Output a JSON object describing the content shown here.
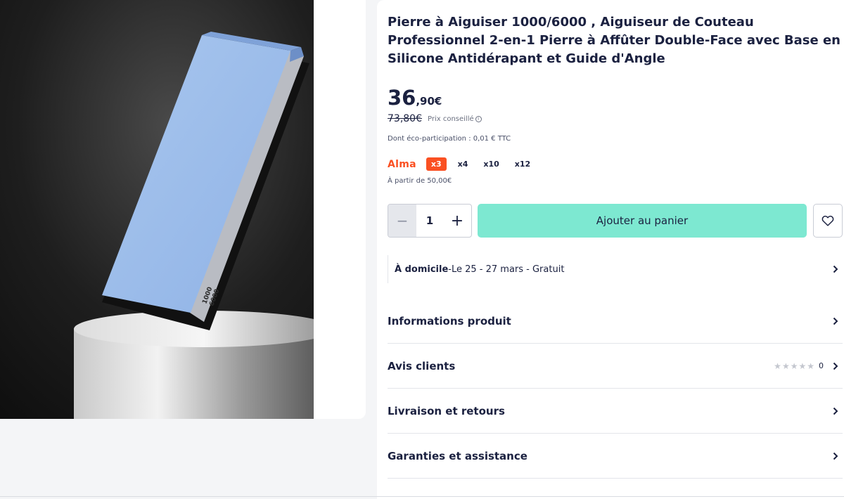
{
  "product": {
    "title": "Pierre à Aiguiser 1000/6000 , Aiguiseur de Couteau Professionnel 2-en-1 Pierre à Affûter Double-Face avec Base en Silicone Antidérapant et Guide d'Angle",
    "stone_label_coarse": "1000",
    "stone_label_fine": "6000"
  },
  "price": {
    "integer": "36",
    "decimal": ",90€",
    "old_price": "73,80€",
    "old_price_label": "Prix conseillé",
    "eco_participation": "Dont éco-participation : 0,01 € TTC"
  },
  "alma": {
    "brand": "Alma",
    "options": [
      "x3",
      "x4",
      "x10",
      "x12"
    ],
    "selected": "x3",
    "minimum": "À partir de 50,00€"
  },
  "cart": {
    "minus": "−",
    "quantity": "1",
    "plus": "+",
    "add_label": "Ajouter au panier"
  },
  "delivery": {
    "mode": "À domicile",
    "separator": " - ",
    "details": "Le 25 - 27 mars - Gratuit"
  },
  "sections": {
    "product_info": "Informations produit",
    "reviews": "Avis clients",
    "reviews_count": "0",
    "reviews_rating": 0,
    "shipping": "Livraison et retours",
    "warranty": "Garanties et assistance"
  },
  "colors": {
    "accent_button": "#7de8d1",
    "alma_orange": "#fa5022",
    "text_primary": "#1b2140"
  }
}
